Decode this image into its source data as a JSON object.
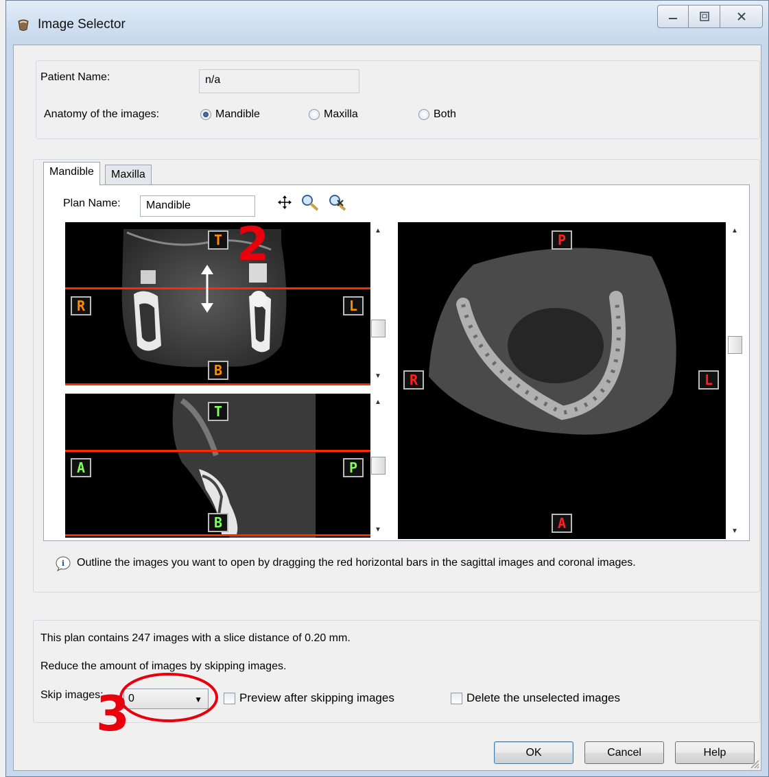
{
  "window": {
    "title": "Image Selector",
    "controls": {
      "minimize": "—",
      "maximize": "□",
      "close": "✕"
    }
  },
  "patient": {
    "name_label": "Patient Name:",
    "name_value": "n/a",
    "anatomy_label": "Anatomy of the images:",
    "anatomy_options": [
      {
        "label": "Mandible",
        "selected": true
      },
      {
        "label": "Maxilla",
        "selected": false
      },
      {
        "label": "Both",
        "selected": false
      }
    ]
  },
  "tabs": [
    {
      "label": "Mandible",
      "active": true
    },
    {
      "label": "Maxilla",
      "active": false
    }
  ],
  "plan": {
    "name_label": "Plan Name:",
    "name_value": "Mandible",
    "tools": [
      "move-icon",
      "zoom-icon",
      "zoom-reset-icon"
    ]
  },
  "viewers": {
    "coronal": {
      "top": "T",
      "bottom": "B",
      "left": "R",
      "right": "L"
    },
    "sagittal": {
      "top": "T",
      "bottom": "B",
      "left": "A",
      "right": "P"
    },
    "axial": {
      "top": "P",
      "bottom": "A",
      "left": "R",
      "right": "L"
    }
  },
  "hint": "Outline the images you want to open by dragging the red horizontal bars in the sagittal images and coronal images.",
  "summary": {
    "line1": "This plan contains 247 images with a slice distance of 0.20 mm.",
    "line2": "Reduce the amount of images by skipping images.",
    "skip_label": "Skip images:",
    "skip_value": "0",
    "preview_label": "Preview after skipping images",
    "delete_label": "Delete the unselected images"
  },
  "buttons": {
    "ok": "OK",
    "cancel": "Cancel",
    "help": "Help"
  },
  "annotations": {
    "step2": "2",
    "step3": "3"
  },
  "colors": {
    "red_bar": "#ff2a00",
    "coronal_label": "#ff8c00",
    "sagittal_label": "#7dff5c",
    "axial_label": "#ff2020",
    "annotation": "#e8000d"
  }
}
